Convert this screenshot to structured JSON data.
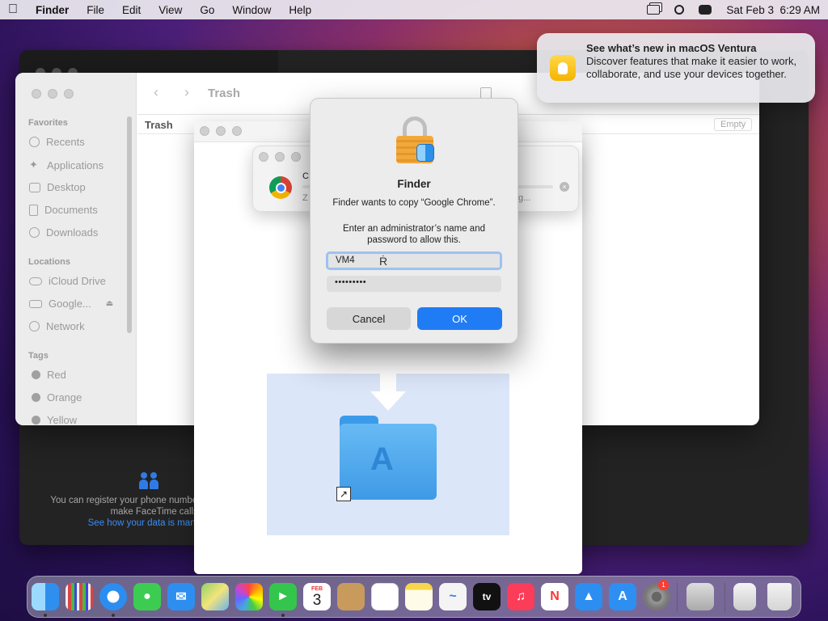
{
  "menubar": {
    "app_name": "Finder",
    "menus": [
      "File",
      "Edit",
      "View",
      "Go",
      "Window",
      "Help"
    ],
    "datetime": "Sat Feb 3  6:29 AM"
  },
  "finder": {
    "title": "Trash",
    "path_label": "Trash",
    "empty_label": "Empty",
    "sidebar": {
      "favorites_heading": "Favorites",
      "favorites": [
        "Recents",
        "Applications",
        "Desktop",
        "Documents",
        "Downloads"
      ],
      "locations_heading": "Locations",
      "locations": [
        "iCloud Drive",
        "Google...",
        "Network"
      ],
      "tags_heading": "Tags",
      "tags": [
        "Red",
        "Orange",
        "Yellow"
      ]
    }
  },
  "facetime": {
    "register_text": "You can register your phone number",
    "register_text2": "make FaceTime calls.",
    "data_link": "See how your data is mana"
  },
  "installer": {
    "progress_title": "C",
    "progress_status": "Z",
    "progress_tail": "g..."
  },
  "dialog": {
    "app_title": "Finder",
    "message": "Finder wants to copy “Google Chrome”.",
    "prompt": "Enter an administrator’s name and password to allow this.",
    "username_value": "VM4",
    "password_value": "•••••••••",
    "cancel_label": "Cancel",
    "ok_label": "OK"
  },
  "notification": {
    "title": "See what’s new in macOS Ventura",
    "body": "Discover features that make it easier to work, collaborate, and use your devices together."
  },
  "dock": {
    "calendar_month": "FEB",
    "calendar_day": "3",
    "tv_label": "tv",
    "settings_badge": "1"
  },
  "colors": {
    "accent": "#1f7cf5",
    "dock_badge": "#ff3b30"
  }
}
